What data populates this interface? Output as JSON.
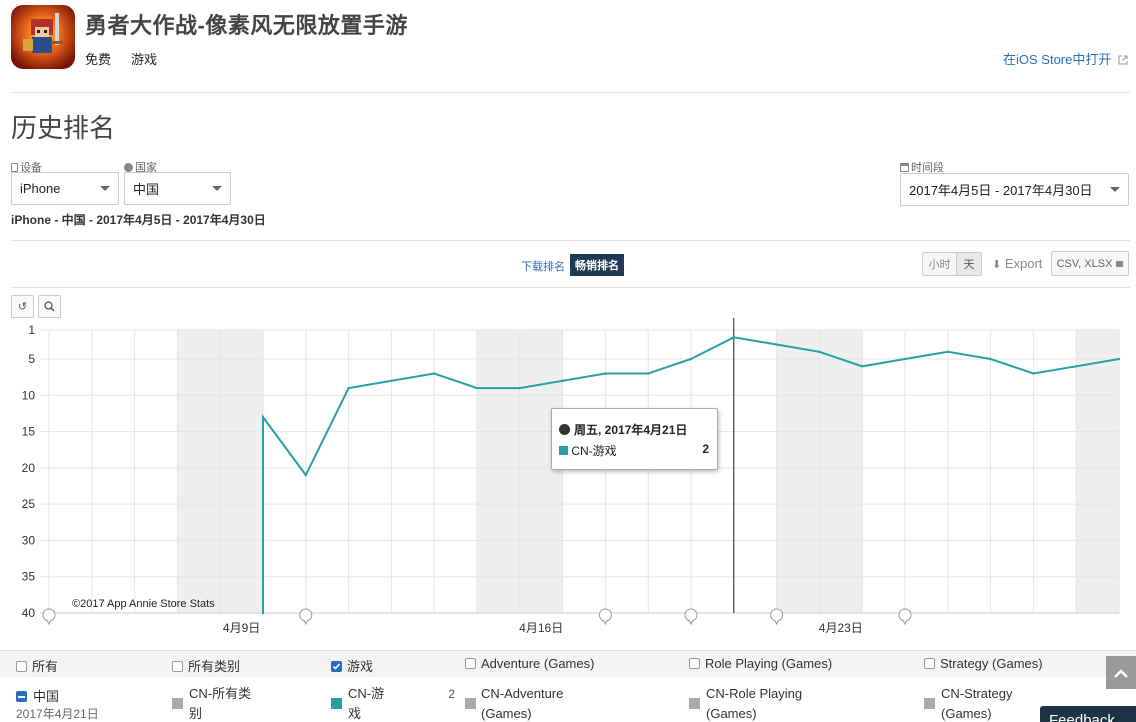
{
  "app": {
    "title": "勇者大作战-像素风无限放置手游",
    "price": "免费",
    "category": "游戏",
    "open_store_link": "在iOS Store中打开"
  },
  "section_title": "历史排名",
  "filters": {
    "device_label": "设备",
    "device_value": "iPhone",
    "country_label": "国家",
    "country_value": "中国",
    "period_label": "时间段",
    "period_value": "2017年4月5日 - 2017年4月30日"
  },
  "summary_text": "iPhone - 中国 - 2017年4月5日 - 2017年4月30日",
  "rank_tabs": {
    "downloads": "下载排名",
    "grossing": "畅销排名"
  },
  "granularity": {
    "hour": "小时",
    "day": "天"
  },
  "export": {
    "label": "Export",
    "formats": "CSV, XLSX"
  },
  "chart_controls": {
    "reset_icon": "reset-zoom-icon",
    "zoom_icon": "zoom-icon"
  },
  "credit": "©2017 App Annie Store Stats",
  "tooltip": {
    "date": "周五, 2017年4月21日",
    "series": "CN-游戏",
    "value": "2"
  },
  "colors": {
    "series": "#26a0a5",
    "weekend": "#efefef",
    "grid": "#e5e5e5",
    "brand_blue": "#2a6ebb"
  },
  "chart_data": {
    "type": "line",
    "y_reversed": true,
    "ylim": [
      1,
      40
    ],
    "yticks": [
      "1",
      "5",
      "10",
      "15",
      "20",
      "25",
      "30",
      "35",
      "40"
    ],
    "ytick_values": [
      1,
      5,
      10,
      15,
      20,
      25,
      30,
      35,
      40
    ],
    "xtick_labels": [
      "4月9日",
      "4月16日",
      "4月23日"
    ],
    "xtick_dates": [
      "2017-04-09",
      "2017-04-16",
      "2017-04-23"
    ],
    "x_start": "2017-04-05",
    "x_end": "2017-04-30",
    "series": [
      {
        "name": "CN-游戏",
        "points": [
          [
            "2017-04-10",
            40
          ],
          [
            "2017-04-10",
            13
          ],
          [
            "2017-04-11",
            21
          ],
          [
            "2017-04-12",
            9
          ],
          [
            "2017-04-13",
            8
          ],
          [
            "2017-04-14",
            7
          ],
          [
            "2017-04-15",
            9
          ],
          [
            "2017-04-16",
            9
          ],
          [
            "2017-04-17",
            8
          ],
          [
            "2017-04-18",
            7
          ],
          [
            "2017-04-19",
            7
          ],
          [
            "2017-04-20",
            5
          ],
          [
            "2017-04-21",
            2
          ],
          [
            "2017-04-22",
            3
          ],
          [
            "2017-04-23",
            4
          ],
          [
            "2017-04-24",
            6
          ],
          [
            "2017-04-25",
            5
          ],
          [
            "2017-04-26",
            4
          ],
          [
            "2017-04-27",
            5
          ],
          [
            "2017-04-28",
            7
          ],
          [
            "2017-04-29",
            6
          ],
          [
            "2017-04-30",
            5
          ]
        ]
      }
    ],
    "crosshair_date": "2017-04-21",
    "event_marker_dates": [
      "2017-04-05",
      "2017-04-11",
      "2017-04-18",
      "2017-04-20",
      "2017-04-22",
      "2017-04-25"
    ]
  },
  "legend": {
    "categories": [
      {
        "label": "所有",
        "checked": false
      },
      {
        "label": "所有类别",
        "checked": false
      },
      {
        "label": "游戏",
        "checked": true
      },
      {
        "label": "Adventure (Games)",
        "checked": false
      },
      {
        "label": "Role Playing (Games)",
        "checked": false
      },
      {
        "label": "Strategy (Games)",
        "checked": false
      }
    ],
    "country": "中国",
    "date": "2017年4月21日",
    "series": [
      {
        "line1": "CN-所有类",
        "line2": "别",
        "value": "",
        "color": "#aaaaaa"
      },
      {
        "line1": "CN-游",
        "line2": "戏",
        "value": "2",
        "color": "#26a0a5"
      },
      {
        "line1": "CN-Adventure",
        "line2": "(Games)",
        "value": "",
        "color": "#aaaaaa"
      },
      {
        "line1": "CN-Role Playing",
        "line2": "(Games)",
        "value": "",
        "color": "#aaaaaa"
      },
      {
        "line1": "CN-Strategy",
        "line2": "(Games)",
        "value": "",
        "color": "#aaaaaa"
      }
    ]
  },
  "feedback_label": "Feedback"
}
